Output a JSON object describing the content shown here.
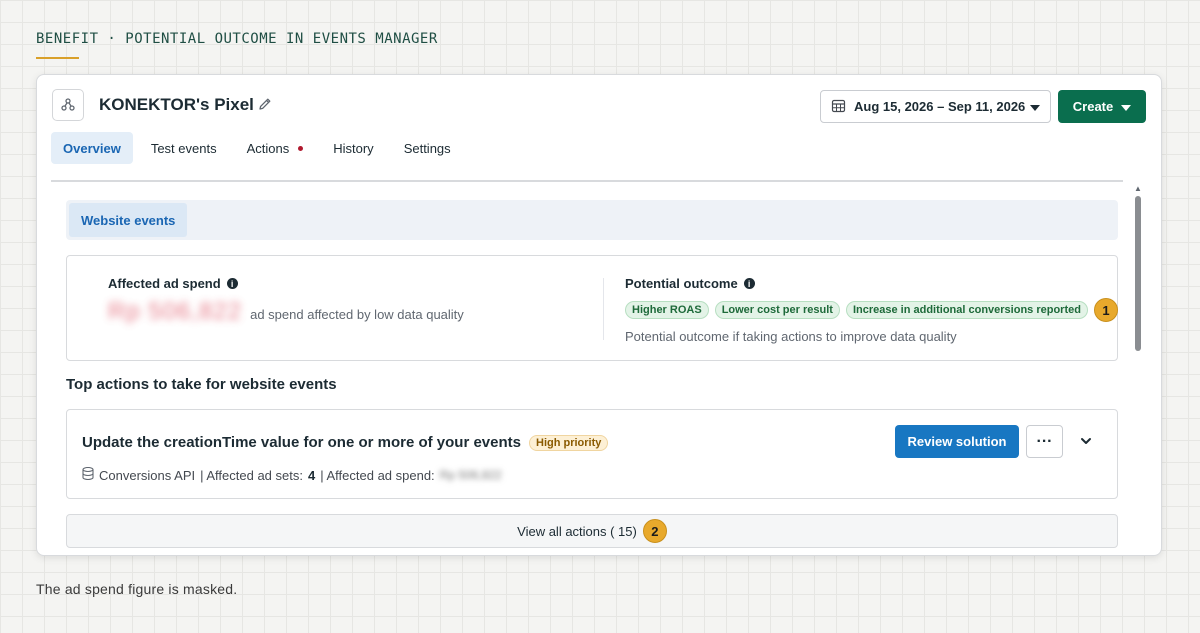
{
  "caption": {
    "title": "BENEFIT · POTENTIAL OUTCOME IN EVENTS MANAGER",
    "note": "The ad spend figure is masked."
  },
  "header": {
    "pixel_name": "KONEKTOR's Pixel",
    "date_range": "Aug 15, 2026 – Sep 11, 2026",
    "create_label": "Create"
  },
  "tabs": [
    {
      "label": "Overview",
      "active": true
    },
    {
      "label": "Test events"
    },
    {
      "label": "Actions",
      "has_dot": true
    },
    {
      "label": "History"
    },
    {
      "label": "Settings"
    }
  ],
  "website_events_tab": "Website events",
  "affected": {
    "label": "Affected ad spend",
    "amount_masked": "Rp 506,822",
    "description": "ad spend affected by low data quality"
  },
  "outcome": {
    "label": "Potential outcome",
    "chips": [
      "Higher ROAS",
      "Lower cost per result",
      "Increase in additional conversions reported"
    ],
    "description": "Potential outcome if taking actions to improve data quality",
    "badge": "1"
  },
  "top_actions": {
    "title": "Top actions to take for website events",
    "action": {
      "title": "Update the creationTime value for one or more of your events",
      "priority": "High priority",
      "source": "Conversions API",
      "ad_sets_label": "| Affected ad sets:",
      "ad_sets_value": "4",
      "spend_label": "| Affected ad spend:",
      "spend_masked": "Rp 506,822",
      "review_label": "Review solution",
      "more_label": "···"
    },
    "view_all_label": "View all actions ( 15)",
    "view_all_badge": "2"
  },
  "colors": {
    "primary_green": "#0a6e4e",
    "primary_blue": "#1877c2",
    "badge_gold": "#e8a92c"
  }
}
